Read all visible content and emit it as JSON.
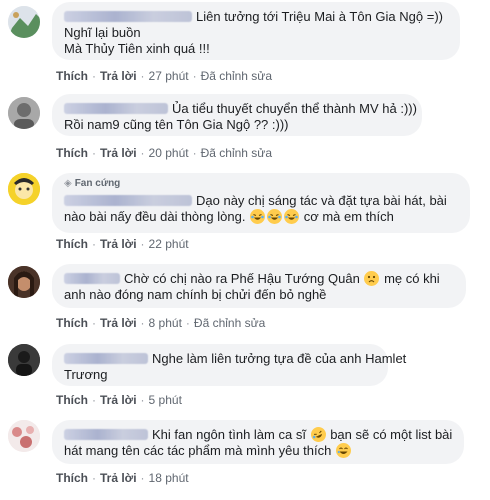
{
  "comments": [
    {
      "text_lines": [
        "Liên tưởng tới Triệu Mai à Tôn Gia Ngộ =))",
        "Nghĩ lại buồn",
        "Mà Thủy Tiên xinh quá !!!"
      ],
      "actions": {
        "like": "Thích",
        "reply": "Trả lời",
        "time": "27 phút",
        "edited": "Đã chỉnh sửa"
      }
    },
    {
      "text_lines": [
        "Ủa tiểu thuyết chuyển thể thành MV hả :)))",
        "Rồi nam9 cũng tên Tôn Gia Ngộ ?? :)))"
      ],
      "actions": {
        "like": "Thích",
        "reply": "Trả lời",
        "time": "20 phút",
        "edited": "Đã chỉnh sửa"
      }
    },
    {
      "badge": "Fan cứng",
      "text_lines": [
        "Dạo này chị sáng tác và đặt tựa bài hát, bài",
        "nào bài nấy đều dài thòng lòng.",
        "cơ mà em thích"
      ],
      "actions": {
        "like": "Thích",
        "reply": "Trả lời",
        "time": "22 phút"
      }
    },
    {
      "text_lines": [
        "Chờ có chị nào ra Phế Hậu Tướng Quân",
        "mẹ có khi",
        "anh nào đóng nam chính bị chửi đến bỏ nghề"
      ],
      "actions": {
        "like": "Thích",
        "reply": "Trả lời",
        "time": "8 phút",
        "edited": "Đã chỉnh sửa"
      }
    },
    {
      "text_lines": [
        "Nghe làm liên tưởng tựa đề của anh Hamlet",
        "Trương"
      ],
      "actions": {
        "like": "Thích",
        "reply": "Trả lời",
        "time": "5 phút"
      }
    },
    {
      "text_lines": [
        "Khi fan ngôn tình làm ca sĩ",
        "bạn sẽ có một list bài",
        "hát mang tên các tác phẩm mà mình yêu thích"
      ],
      "actions": {
        "like": "Thích",
        "reply": "Trả lời",
        "time": "18 phút"
      }
    }
  ],
  "colors": {
    "bubble": "#f2f3f5",
    "link": "#4b4f56",
    "meta": "#606770"
  }
}
